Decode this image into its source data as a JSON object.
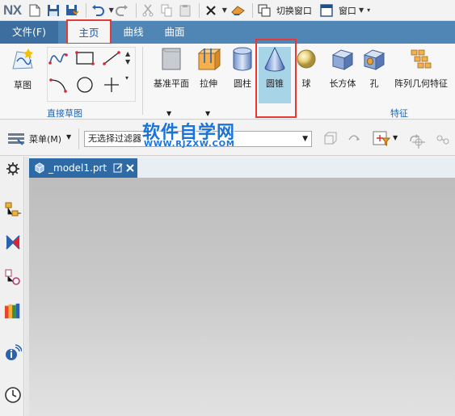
{
  "app": {
    "logo": "NX"
  },
  "quick_access": {
    "switch_window_label": "切换窗口",
    "window_label": "窗口"
  },
  "tabs": [
    {
      "label": "文件(F)",
      "selected": false
    },
    {
      "label": "主页",
      "selected": true
    },
    {
      "label": "曲线",
      "selected": false
    },
    {
      "label": "曲面",
      "selected": false
    }
  ],
  "ribbon": {
    "sketch_label": "草图",
    "direct_sketch_group": "直接草图",
    "feature_group": "特征",
    "tools": [
      {
        "label": "基准平面"
      },
      {
        "label": "拉伸"
      },
      {
        "label": "圆柱"
      },
      {
        "label": "圆锥"
      },
      {
        "label": "球"
      },
      {
        "label": "长方体"
      },
      {
        "label": "孔"
      },
      {
        "label": "阵列几何特征"
      }
    ]
  },
  "toolbar": {
    "menu_label": "菜单(M)",
    "filter_value": "无选择过滤器"
  },
  "watermark": {
    "title": "软件自学网",
    "url": "WWW.RJZXW.COM"
  },
  "document": {
    "tab_label": "_model1.prt"
  },
  "colors": {
    "ribbon_tab_bar": "#4f86b5",
    "file_tab": "#3c6f9f",
    "accent_blue": "#1e64b4",
    "highlight_red": "#e53935",
    "cone_highlight": "#a8d4e8",
    "doc_tab": "#2e6aa6"
  }
}
